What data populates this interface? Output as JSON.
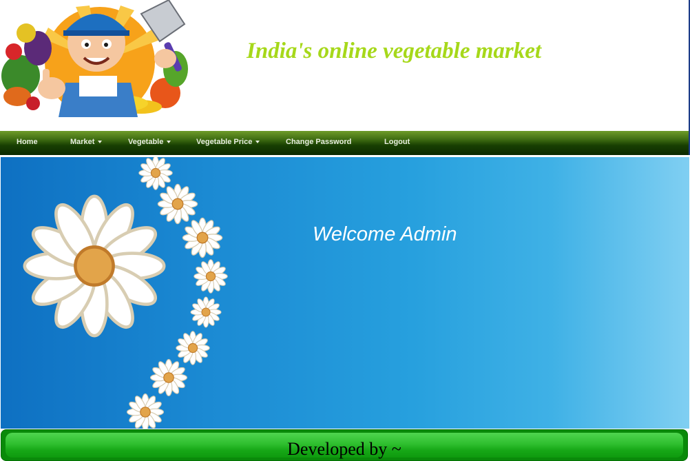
{
  "header": {
    "site_title": "India's online vegetable market",
    "logo_icon": "farmer-with-vegetables-logo"
  },
  "nav": {
    "items": [
      {
        "label": "Home",
        "dropdown": false
      },
      {
        "label": "Market",
        "dropdown": true
      },
      {
        "label": "Vegetable",
        "dropdown": true
      },
      {
        "label": "Vegetable Price",
        "dropdown": true
      },
      {
        "label": "Change Password",
        "dropdown": false
      },
      {
        "label": "Logout",
        "dropdown": false
      }
    ]
  },
  "hero": {
    "welcome_text": "Welcome Admin",
    "decoration": "daisy-flowers-icon"
  },
  "footer": {
    "text": "Developed by ~"
  },
  "colors": {
    "title": "#a6d81a",
    "nav_bg": "#183f02",
    "hero_left": "#0e70c2",
    "hero_right": "#80cff2",
    "footer": "#2fbf2f"
  }
}
